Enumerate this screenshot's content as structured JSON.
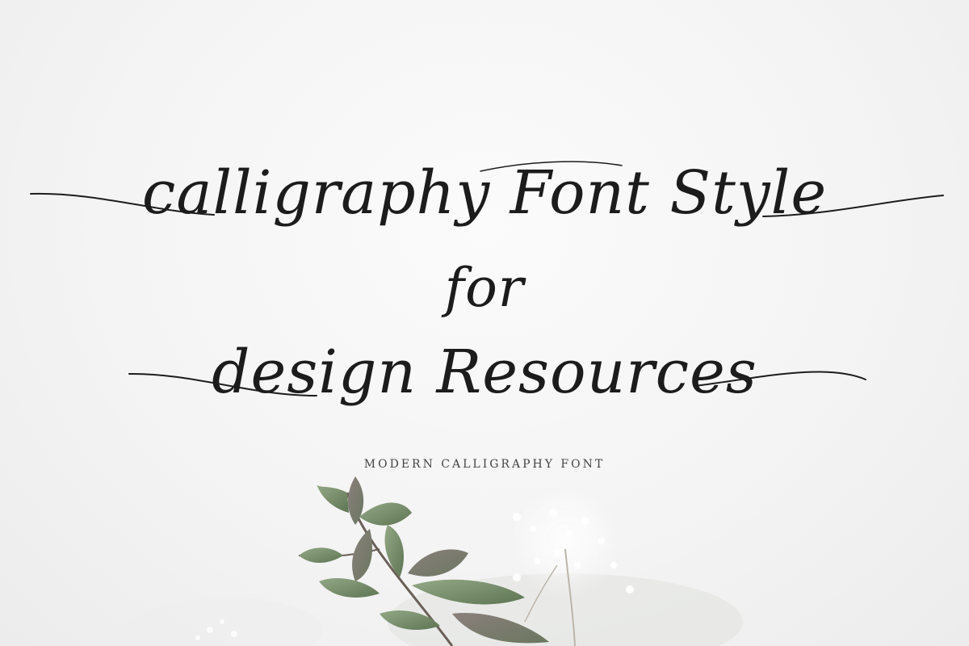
{
  "headline": {
    "line1": "calligraphy Font Style",
    "line2": "for",
    "line3": "design Resources"
  },
  "tagline": "MODERN CALLIGRAPHY FONT",
  "colors": {
    "ink": "#1c1c1c",
    "background": "#f6f6f6",
    "leaf": "#7e9770",
    "leaf_dark": "#5e7553",
    "blossom": "#ffffff"
  }
}
